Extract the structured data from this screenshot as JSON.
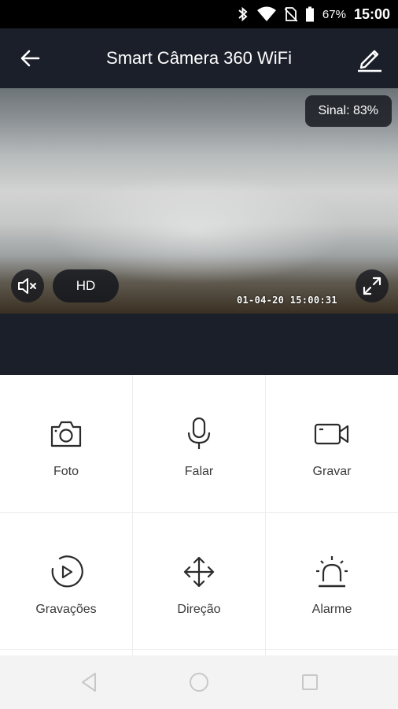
{
  "status_bar": {
    "battery": "67%",
    "time": "15:00"
  },
  "header": {
    "title": "Smart Câmera 360 WiFi",
    "back_icon": "arrow-left-icon",
    "edit_icon": "pencil-icon"
  },
  "video": {
    "signal": "Sinal: 83%",
    "quality": "HD",
    "timestamp": "01-04-20  15:00:31",
    "mute_icon": "speaker-muted-icon",
    "fullscreen_icon": "fullscreen-icon"
  },
  "controls": [
    {
      "label": "Foto",
      "icon": "camera-icon"
    },
    {
      "label": "Falar",
      "icon": "microphone-icon"
    },
    {
      "label": "Gravar",
      "icon": "video-camera-icon"
    },
    {
      "label": "Gravações",
      "icon": "playback-icon"
    },
    {
      "label": "Direção",
      "icon": "move-arrows-icon"
    },
    {
      "label": "Alarme",
      "icon": "alarm-siren-icon"
    }
  ],
  "colors": {
    "header_bg": "#1b1f2a",
    "icon_dark": "#2b2b2b"
  }
}
